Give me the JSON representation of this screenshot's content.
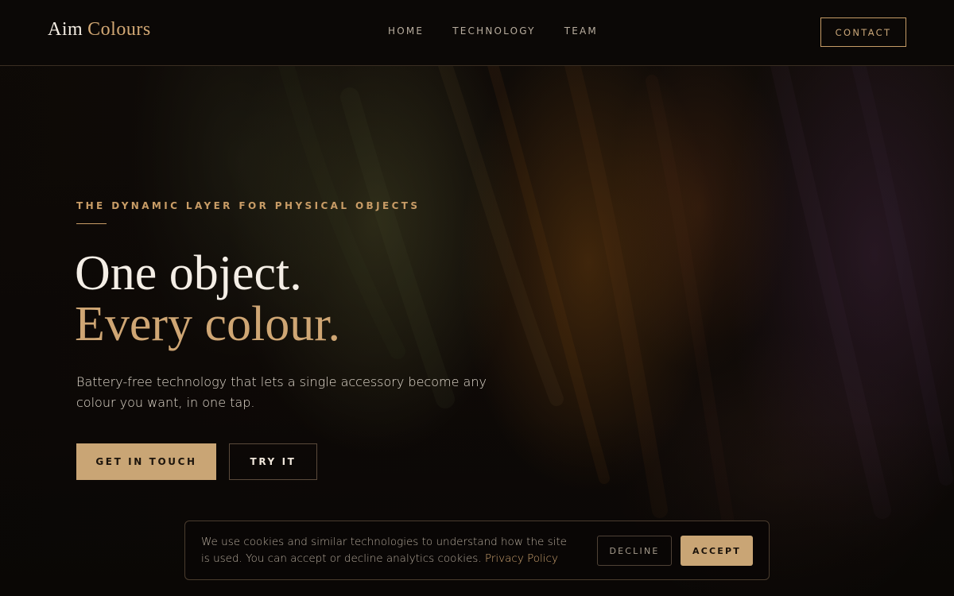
{
  "header": {
    "logo_main": "Aim",
    "logo_accent": "Colours",
    "nav": [
      {
        "label": "HOME"
      },
      {
        "label": "TECHNOLOGY"
      },
      {
        "label": "TEAM"
      }
    ],
    "contact_label": "CONTACT"
  },
  "hero": {
    "eyebrow": "THE DYNAMIC LAYER FOR PHYSICAL OBJECTS",
    "headline_line1": "One object.",
    "headline_line2": "Every colour.",
    "subtext": "Battery-free technology that lets a single accessory become any colour you want, in one tap.",
    "primary_cta": "GET IN TOUCH",
    "secondary_cta": "TRY IT"
  },
  "cookie_banner": {
    "text": "We use cookies and similar technologies to understand how the site is used. You can accept or decline analytics cookies.",
    "link_label": "Privacy Policy",
    "decline_label": "DECLINE",
    "accept_label": "ACCEPT"
  },
  "colors": {
    "accent": "#c9a575",
    "background": "#0b0806",
    "heading_light": "#f4eee6"
  }
}
